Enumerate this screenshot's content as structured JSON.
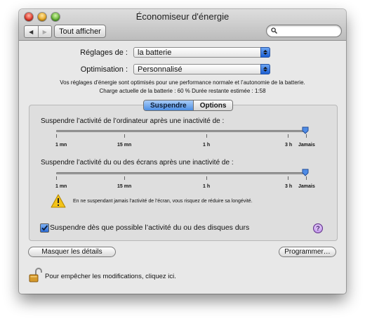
{
  "window": {
    "title": "Économiseur d'énergie"
  },
  "toolbar": {
    "back_icon": "◀",
    "forward_icon": "▶",
    "show_all_label": "Tout afficher",
    "search_placeholder": "",
    "search_value": ""
  },
  "settings": {
    "settings_for_label": "Réglages de :",
    "settings_for_value": "la batterie",
    "optimization_label": "Optimisation :",
    "optimization_value": "Personnalisé"
  },
  "info": {
    "line1": "Vos réglages d’énergie sont optimisés pour une performance normale et l’autonomie de la batterie.",
    "line2": "Charge actuelle de la batterie : 60 %  Durée restante estimée : 1:58"
  },
  "tabs": {
    "sleep": "Suspendre",
    "options": "Options"
  },
  "sliders": {
    "computer": {
      "label": "Suspendre l’activité de l’ordinateur après une inactivité de :",
      "value": "Jamais"
    },
    "display": {
      "label": "Suspendre l’activité du ou des écrans après une inactivité de :",
      "value": "Jamais"
    },
    "ticks": {
      "t1": "1 mn",
      "t15": "15 mn",
      "t1h": "1 h",
      "t3h": "3 h",
      "never": "Jamais"
    }
  },
  "warning": {
    "text": "En ne suspendant jamais l’activité de l’écran, vous risquez de réduire sa longévité."
  },
  "disk": {
    "label": "Suspendre dès que possible l’activité du ou des disques durs",
    "checked": true
  },
  "help_label": "?",
  "buttons": {
    "hide_details": "Masquer les détails",
    "schedule": "Programmer…"
  },
  "lock": {
    "text": "Pour empêcher les modifications, cliquez ici."
  },
  "colors": {
    "accent_blue": "#2a6bd6",
    "warning_yellow": "#f3c318",
    "help_purple": "#b685e4"
  }
}
